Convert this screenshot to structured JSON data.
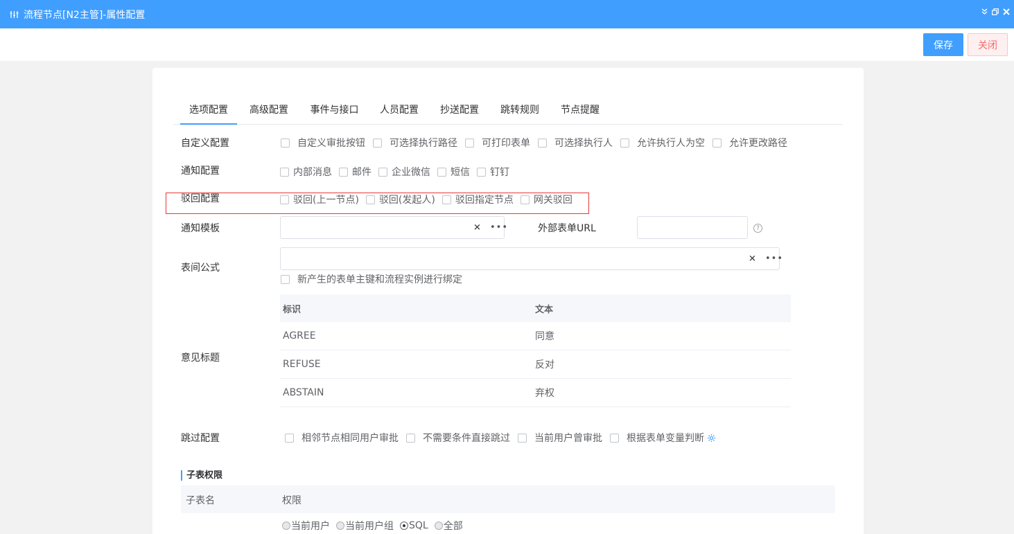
{
  "window": {
    "title": "流程节点[N2主管]-属性配置",
    "controls": [
      "collapse-icon",
      "restore-icon",
      "close-icon"
    ]
  },
  "toolbar": {
    "save_label": "保存",
    "close_label": "关闭"
  },
  "tabs": [
    {
      "label": "选项配置",
      "active": true
    },
    {
      "label": "高级配置"
    },
    {
      "label": "事件与接口"
    },
    {
      "label": "人员配置"
    },
    {
      "label": "抄送配置"
    },
    {
      "label": "跳转规则"
    },
    {
      "label": "节点提醒"
    }
  ],
  "custom_config": {
    "label": "自定义配置",
    "options": [
      "自定义审批按钮",
      "可选择执行路径",
      "可打印表单",
      "可选择执行人",
      "允许执行人为空",
      "允许更改路径"
    ]
  },
  "notify_config": {
    "label": "通知配置",
    "options": [
      "内部消息",
      "邮件",
      "企业微信",
      "短信",
      "钉钉"
    ]
  },
  "reject_config": {
    "label": "驳回配置",
    "options": [
      "驳回(上一节点)",
      "驳回(发起人)",
      "驳回指定节点",
      "网关驳回"
    ]
  },
  "notify_template": {
    "label": "通知模板",
    "value": ""
  },
  "external_url": {
    "label": "外部表单URL",
    "value": ""
  },
  "formula": {
    "label": "表间公式",
    "value": "",
    "bind_option": "新产生的表单主键和流程实例进行绑定"
  },
  "opinion": {
    "label": "意见标题",
    "columns": [
      "标识",
      "文本"
    ],
    "rows": [
      [
        "AGREE",
        "同意"
      ],
      [
        "REFUSE",
        "反对"
      ],
      [
        "ABSTAIN",
        "弃权"
      ]
    ]
  },
  "skip_config": {
    "label": "跳过配置",
    "options": [
      "相邻节点相同用户审批",
      "不需要条件直接跳过",
      "当前用户曾审批",
      "根据表单变量判断"
    ]
  },
  "subtable": {
    "section_title": "子表权限",
    "columns": [
      "子表名",
      "权限"
    ],
    "radio_options": [
      "当前用户",
      "当前用户组",
      "SQL",
      "全部"
    ],
    "selected": "SQL"
  },
  "colors": {
    "primary": "#409eff",
    "danger": "#f56c6c",
    "highlight_border": "#e53935"
  }
}
